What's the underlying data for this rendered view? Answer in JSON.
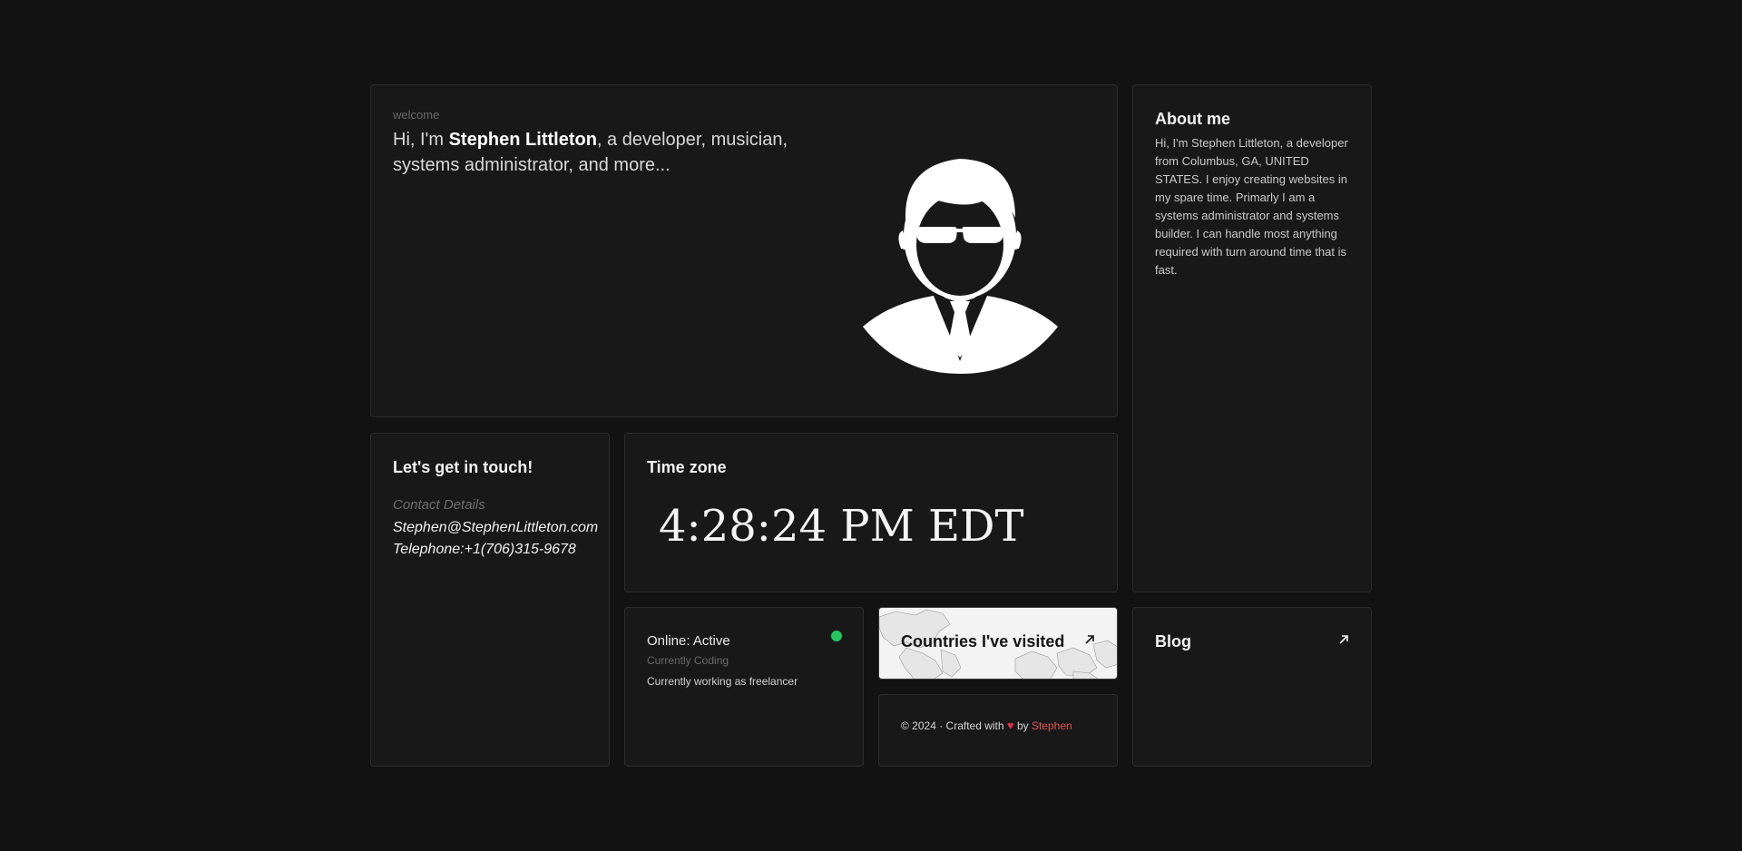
{
  "welcome": {
    "label": "welcome",
    "greeting_prefix": "Hi, I'm ",
    "name": "Stephen Littleton",
    "greeting_suffix": ", a developer, musician, systems administrator, and more..."
  },
  "about": {
    "title": "About me",
    "text": "Hi, I'm Stephen Littleton, a developer from Columbus, GA, UNITED STATES. I enjoy creating websites in my spare time. Primarly I am a systems administrator and systems builder. I can handle most anything required with turn around time that is fast."
  },
  "contact": {
    "title": "Let's get in touch!",
    "label": "Contact Details",
    "email": "Stephen@StephenLittleton.com",
    "phone": "Telephone:+1(706)315-9678"
  },
  "timezone": {
    "title": "Time zone",
    "clock": "4:28:24 PM EDT"
  },
  "status": {
    "online": "Online: Active",
    "activity": "Currently Coding",
    "work": "Currently working as freelancer",
    "dot_color": "#22c55e"
  },
  "countries": {
    "title": "Countries I've visited",
    "icon": "arrow-up-right-icon"
  },
  "footer": {
    "prefix": "© 2024 · Crafted with ",
    "heart": "♥",
    "middle": " by ",
    "author": "Stephen"
  },
  "blog": {
    "title": "Blog",
    "icon": "arrow-up-right-icon"
  }
}
